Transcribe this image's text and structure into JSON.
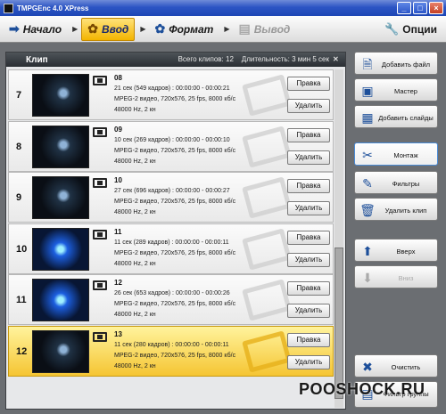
{
  "window": {
    "title": "TMPGEnc 4.0 XPress"
  },
  "toolbar": {
    "steps": [
      {
        "label": "Начало"
      },
      {
        "label": "Ввод"
      },
      {
        "label": "Формат"
      },
      {
        "label": "Вывод"
      }
    ],
    "options_label": "Опции"
  },
  "panel": {
    "title": "Клип",
    "total_clips": "Всего клипов: 12",
    "duration": "Длительность: 3 мин 5 сек"
  },
  "clips": [
    {
      "num": "7",
      "name": "08",
      "line1": "21 сек (549 кадров) : 00:00:00 - 00:00:21",
      "line2": "MPEG-2 видео,  720x576,  25 fps,  8000 кб/с",
      "line3": "48000 Hz, 2 кн",
      "edit": "Правка",
      "delete": "Удалить"
    },
    {
      "num": "8",
      "name": "09",
      "line1": "10 сек (269 кадров) : 00:00:00 - 00:00:10",
      "line2": "MPEG-2 видео,  720x576,  25 fps,  8000 кб/с",
      "line3": "48000 Hz, 2 кн",
      "edit": "Правка",
      "delete": "Удалить"
    },
    {
      "num": "9",
      "name": "10",
      "line1": "27 сек (696 кадров) : 00:00:00 - 00:00:27",
      "line2": "MPEG-2 видео,  720x576,  25 fps,  8000 кб/с",
      "line3": "48000 Hz, 2 кн",
      "edit": "Правка",
      "delete": "Удалить"
    },
    {
      "num": "10",
      "name": "11",
      "line1": "11 сек (289 кадров) : 00:00:00 - 00:00:11",
      "line2": "MPEG-2 видео,  720x576,  25 fps,  8000 кб/с",
      "line3": "48000 Hz, 2 кн",
      "edit": "Правка",
      "delete": "Удалить"
    },
    {
      "num": "11",
      "name": "12",
      "line1": "26 сек (653 кадров) : 00:00:00 - 00:00:26",
      "line2": "MPEG-2 видео,  720x576,  25 fps,  8000 кб/с",
      "line3": "48000 Hz, 2 кн",
      "edit": "Правка",
      "delete": "Удалить"
    },
    {
      "num": "12",
      "name": "13",
      "line1": "11 сек (280 кадров) : 00:00:00 - 00:00:11",
      "line2": "MPEG-2 видео,  720x576,  25 fps,  8000 кб/с",
      "line3": "48000 Hz, 2 кн",
      "edit": "Правка",
      "delete": "Удалить"
    }
  ],
  "side": {
    "add_file": "Добавить файл",
    "wizard": "Мастер",
    "add_slides": "Добавить слайды",
    "montage": "Монтаж",
    "filters": "Фильтры",
    "delete_clip": "Удалить клип",
    "up": "Вверх",
    "down": "Вниз",
    "clear": "Очистить",
    "group_filter": "Фильтр группы"
  },
  "watermark": "POOSHOCK.RU"
}
